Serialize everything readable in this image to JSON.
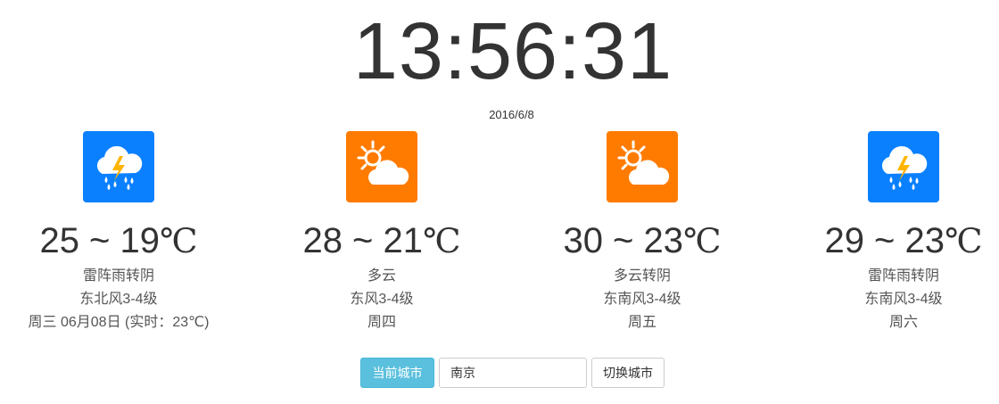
{
  "clock": {
    "time": "13:56:31"
  },
  "date": "2016/6/8",
  "unit": "℃",
  "days": [
    {
      "icon": "thunderstorm-icon",
      "temp": "25 ~ 19",
      "weather": "雷阵雨转阴",
      "wind": "东北风3-4级",
      "day": "周三 06月08日 (实时：23℃)",
      "icon_bg": "#007bff"
    },
    {
      "icon": "partly-cloudy-icon",
      "temp": "28 ~ 21",
      "weather": "多云",
      "wind": "东风3-4级",
      "day": "周四",
      "icon_bg": "#ff7a00"
    },
    {
      "icon": "partly-cloudy-icon",
      "temp": "30 ~ 23",
      "weather": "多云转阴",
      "wind": "东南风3-4级",
      "day": "周五",
      "icon_bg": "#ff7a00"
    },
    {
      "icon": "thunderstorm-icon",
      "temp": "29 ~ 23",
      "weather": "雷阵雨转阴",
      "wind": "东南风3-4级",
      "day": "周六",
      "icon_bg": "#007bff"
    }
  ],
  "controls": {
    "current_city_label": "当前城市",
    "city_value": "南京",
    "switch_label": "切换城市"
  },
  "colors": {
    "info_button": "#5bc0de",
    "storm_bg": "#007bff",
    "sun_bg": "#ff7a00"
  }
}
